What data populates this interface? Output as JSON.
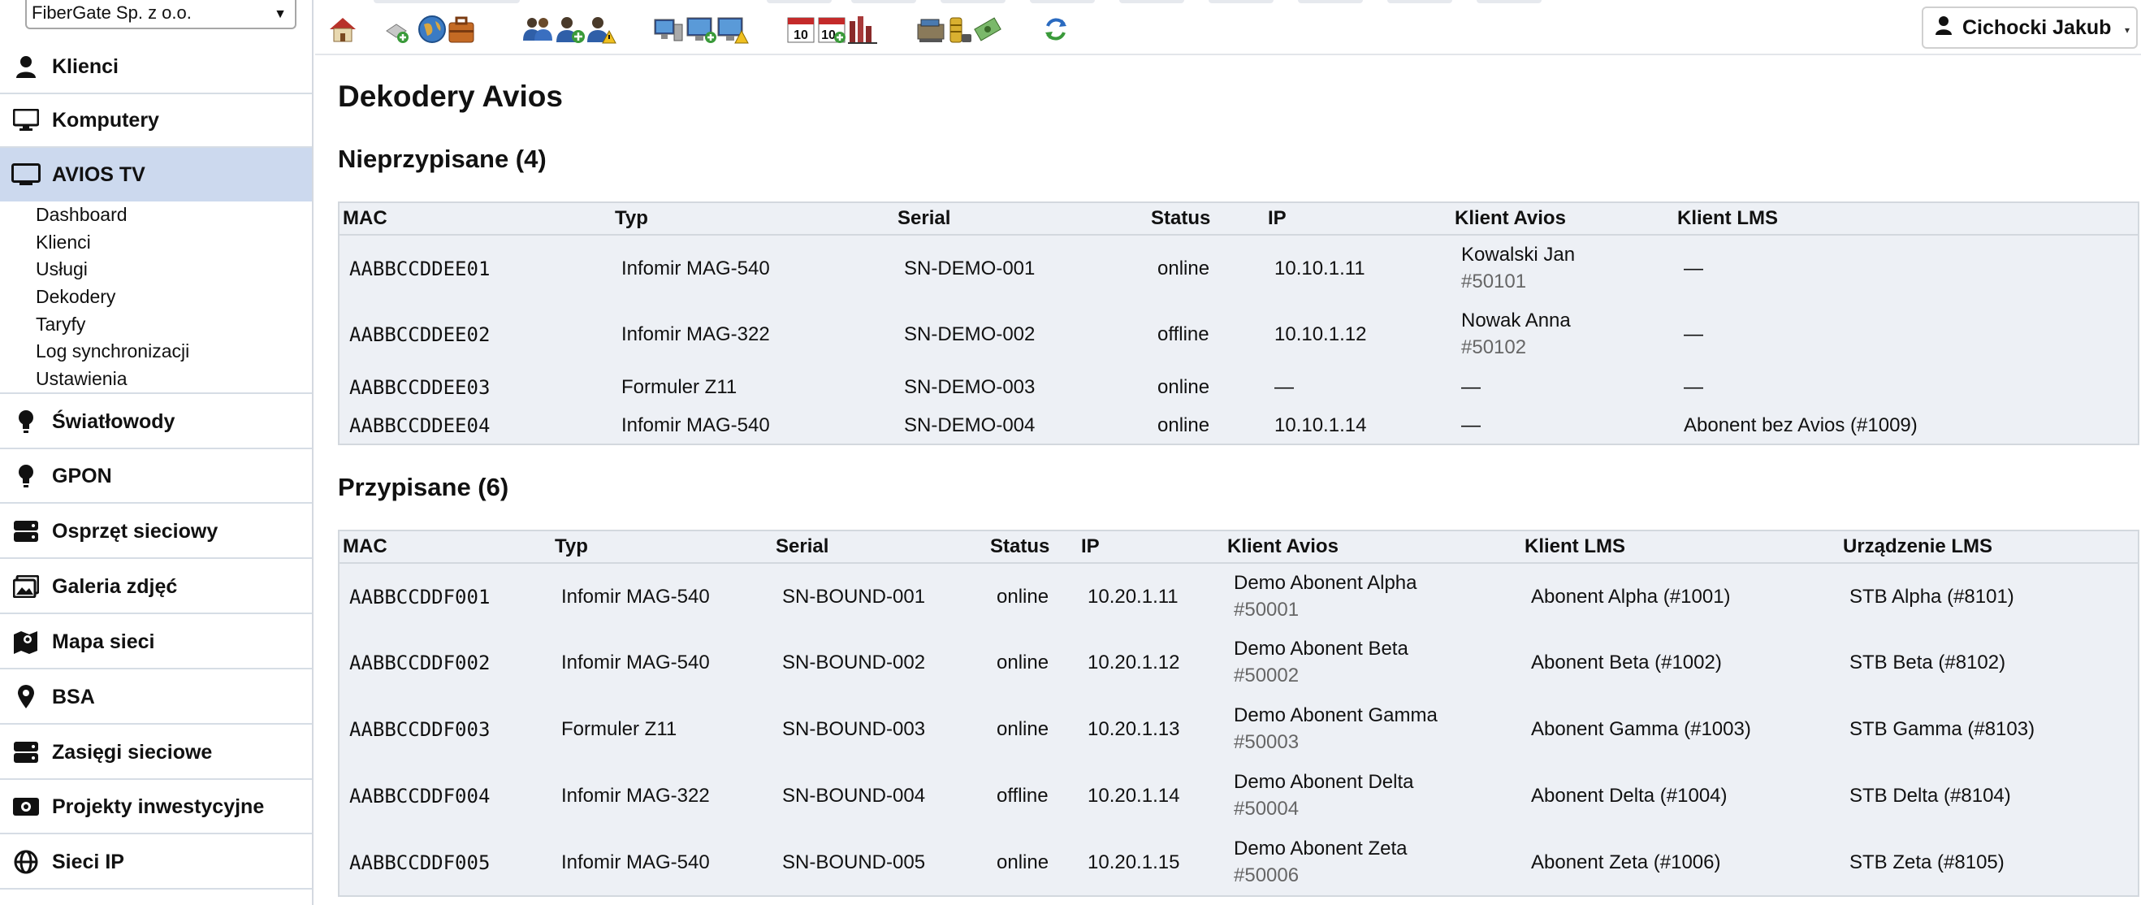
{
  "company_select": {
    "value": "FiberGate Sp. z o.o."
  },
  "sidebar": {
    "items": [
      {
        "label": "Klienci",
        "icon": "person-icon"
      },
      {
        "label": "Komputery",
        "icon": "monitor-icon"
      },
      {
        "label": "AVIOS TV",
        "icon": "tv-icon"
      },
      {
        "label": "Światłowody",
        "icon": "lightbulb-icon"
      },
      {
        "label": "GPON",
        "icon": "lightbulb-icon"
      },
      {
        "label": "Osprzęt sieciowy",
        "icon": "server-icon"
      },
      {
        "label": "Galeria zdjęć",
        "icon": "image-icon"
      },
      {
        "label": "Mapa sieci",
        "icon": "map-icon"
      },
      {
        "label": "BSA",
        "icon": "map-pin-icon"
      },
      {
        "label": "Zasięgi sieciowe",
        "icon": "server-icon"
      },
      {
        "label": "Projekty inwestycyjne",
        "icon": "money-icon"
      },
      {
        "label": "Sieci IP",
        "icon": "globe-icon"
      }
    ],
    "avios_submenu": [
      "Dashboard",
      "Klienci",
      "Usługi",
      "Dekodery",
      "Taryfy",
      "Log synchronizacji",
      "Ustawienia"
    ]
  },
  "user": {
    "name": "Cichocki Jakub"
  },
  "page": {
    "title": "Dekodery Avios",
    "unassigned_title": "Nieprzypisane (4)",
    "assigned_title": "Przypisane (6)"
  },
  "unassigned": {
    "headers": [
      "MAC",
      "Typ",
      "Serial",
      "Status",
      "IP",
      "Klient Avios",
      "Klient LMS"
    ],
    "rows": [
      {
        "mac": "AABBCCDDEE01",
        "type": "Infomir MAG-540",
        "serial": "SN-DEMO-001",
        "status": "online",
        "ip": "10.10.1.11",
        "avios_name": "Kowalski Jan",
        "avios_id": "#50101",
        "lms": "—"
      },
      {
        "mac": "AABBCCDDEE02",
        "type": "Infomir MAG-322",
        "serial": "SN-DEMO-002",
        "status": "offline",
        "ip": "10.10.1.12",
        "avios_name": "Nowak Anna",
        "avios_id": "#50102",
        "lms": "—"
      },
      {
        "mac": "AABBCCDDEE03",
        "type": "Formuler Z11",
        "serial": "SN-DEMO-003",
        "status": "online",
        "ip": "—",
        "avios_name": "—",
        "avios_id": "",
        "lms": "—"
      },
      {
        "mac": "AABBCCDDEE04",
        "type": "Infomir MAG-540",
        "serial": "SN-DEMO-004",
        "status": "online",
        "ip": "10.10.1.14",
        "avios_name": "—",
        "avios_id": "",
        "lms": "Abonent bez Avios (#1009)"
      }
    ]
  },
  "assigned": {
    "headers": [
      "MAC",
      "Typ",
      "Serial",
      "Status",
      "IP",
      "Klient Avios",
      "Klient LMS",
      "Urządzenie LMS"
    ],
    "rows": [
      {
        "mac": "AABBCCDDF001",
        "type": "Infomir MAG-540",
        "serial": "SN-BOUND-001",
        "status": "online",
        "ip": "10.20.1.11",
        "avios_name": "Demo Abonent Alpha",
        "avios_id": "#50001",
        "lms": "Abonent Alpha (#1001)",
        "device": "STB Alpha (#8101)"
      },
      {
        "mac": "AABBCCDDF002",
        "type": "Infomir MAG-540",
        "serial": "SN-BOUND-002",
        "status": "online",
        "ip": "10.20.1.12",
        "avios_name": "Demo Abonent Beta",
        "avios_id": "#50002",
        "lms": "Abonent Beta (#1002)",
        "device": "STB Beta (#8102)"
      },
      {
        "mac": "AABBCCDDF003",
        "type": "Formuler Z11",
        "serial": "SN-BOUND-003",
        "status": "online",
        "ip": "10.20.1.13",
        "avios_name": "Demo Abonent Gamma",
        "avios_id": "#50003",
        "lms": "Abonent Gamma (#1003)",
        "device": "STB Gamma (#8103)"
      },
      {
        "mac": "AABBCCDDF004",
        "type": "Infomir MAG-322",
        "serial": "SN-BOUND-004",
        "status": "offline",
        "ip": "10.20.1.14",
        "avios_name": "Demo Abonent Delta",
        "avios_id": "#50004",
        "lms": "Abonent Delta (#1004)",
        "device": "STB Delta (#8104)"
      },
      {
        "mac": "AABBCCDDF005",
        "type": "Infomir MAG-540",
        "serial": "SN-BOUND-005",
        "status": "online",
        "ip": "10.20.1.15",
        "avios_name": "Demo Abonent Zeta",
        "avios_id": "#50006",
        "lms": "Abonent Zeta (#1006)",
        "device": "STB Zeta (#8105)"
      }
    ]
  }
}
